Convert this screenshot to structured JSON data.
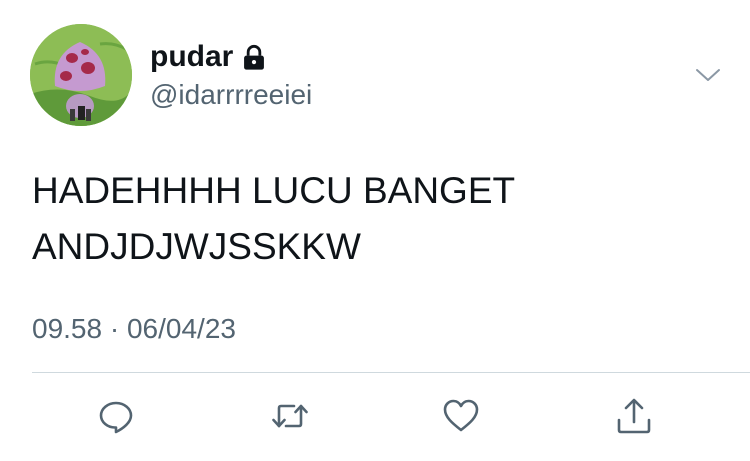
{
  "user": {
    "display_name": "pudar",
    "handle": "@idarrrreeiei",
    "protected_icon": "lock-icon",
    "avatar": "cartoon-mushroom-avatar"
  },
  "tweet": {
    "lines": [
      "HADEHHHH LUCU BANGET",
      "ANDJDJWJSSKKW"
    ],
    "time": "09.58",
    "separator": "·",
    "date": "06/04/23"
  },
  "actions": [
    {
      "name": "reply",
      "icon": "reply-icon"
    },
    {
      "name": "retweet",
      "icon": "retweet-icon"
    },
    {
      "name": "like",
      "icon": "heart-icon"
    },
    {
      "name": "share",
      "icon": "share-icon"
    }
  ],
  "colors": {
    "text_primary": "#0f1419",
    "text_secondary": "#536471",
    "divider": "#cfd9de",
    "icon": "#536471"
  }
}
